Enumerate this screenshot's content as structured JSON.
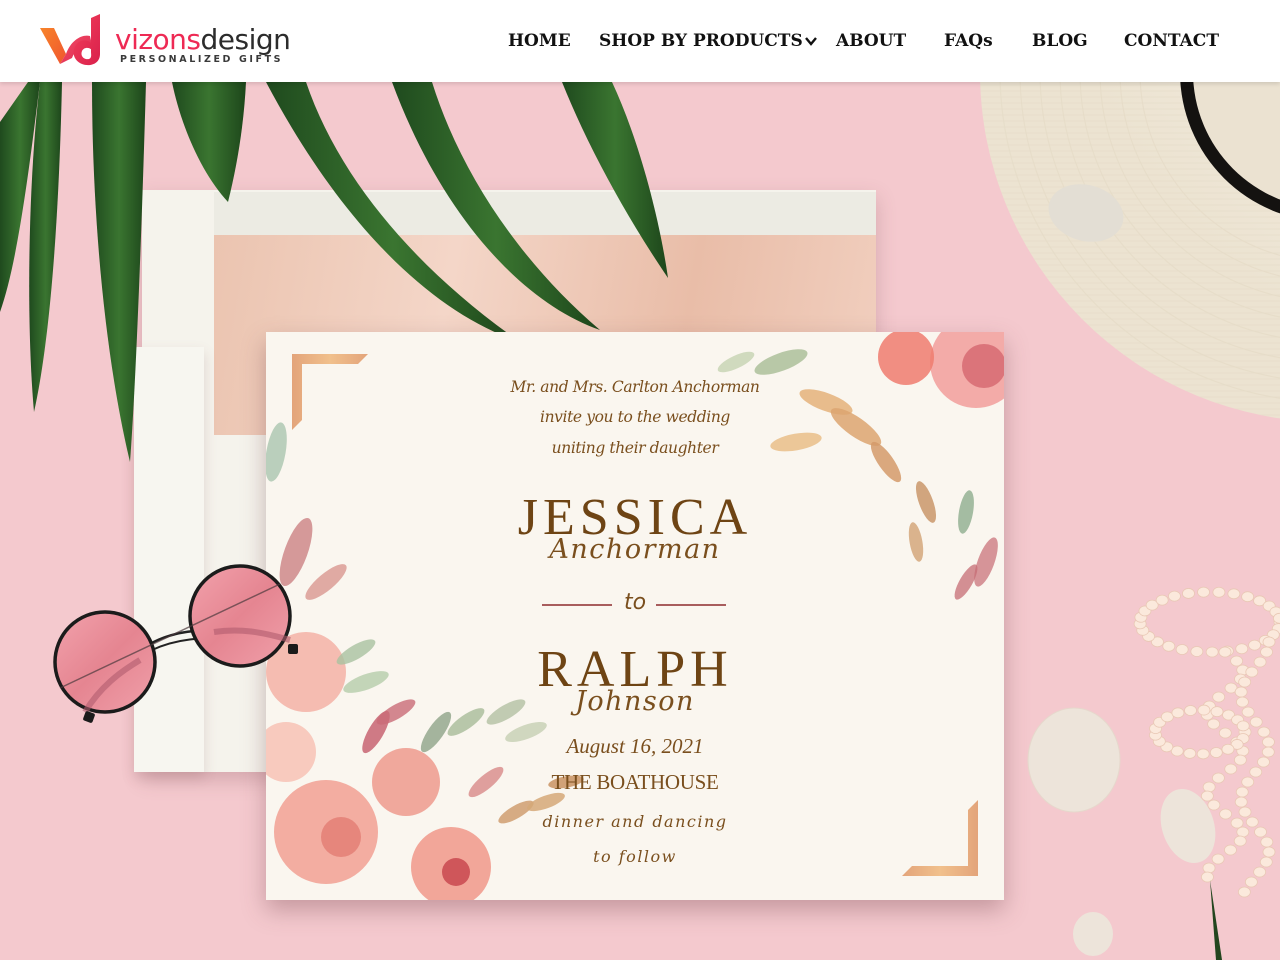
{
  "brand": {
    "name_part1": "vizons",
    "name_part2": "design",
    "tagline": "PERSONALIZED GIFTS",
    "logo_mark": "vd-logo-mark",
    "colors": {
      "orange": "#f26a2e",
      "red": "#ee2a54",
      "dark": "#2c2c2c"
    }
  },
  "nav": {
    "items": [
      {
        "label": "HOME"
      },
      {
        "label": "SHOP BY PRODUCTS",
        "icon": "chevron-down-icon"
      },
      {
        "label": "ABOUT"
      },
      {
        "label": "FAQs"
      },
      {
        "label": "BLOG"
      },
      {
        "label": "CONTACT"
      }
    ]
  },
  "invitation": {
    "intro_lines": [
      "Mr. and Mrs. Carlton Anchorman",
      "invite you to the wedding",
      "uniting their daughter"
    ],
    "bride_first": "JESSICA",
    "bride_last": "Anchorman",
    "connector": "to",
    "groom_first": "RALPH",
    "groom_last": "Johnson",
    "date": "August 16, 2021",
    "venue": "THE BOATHOUSE",
    "after_lines": [
      "dinner and dancing",
      "to follow"
    ],
    "colors": {
      "text": "#7a4f1e",
      "rule": "#a85d5d",
      "corner": "#e8a878",
      "paper": "#faf6ef"
    }
  },
  "scene": {
    "background_color": "#f4c9ce",
    "props": [
      "palm-leaves",
      "envelope",
      "sunglasses",
      "straw-hat",
      "pebbles",
      "pearl-necklace"
    ]
  }
}
